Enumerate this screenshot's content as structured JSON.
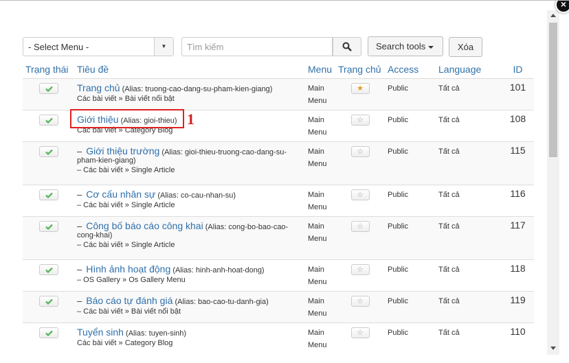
{
  "close_label": "×",
  "toolbar": {
    "select_menu_value": "- Select Menu -",
    "search_placeholder": "Tìm kiếm",
    "search_tools_label": "Search tools",
    "clear_label": "Xóa"
  },
  "table": {
    "headers": {
      "status": "Trạng thái",
      "title": "Tiêu đề",
      "menu": "Menu",
      "home": "Trạng chủ",
      "access": "Access",
      "language": "Language",
      "id": "ID"
    },
    "rows": [
      {
        "title": "Trang chủ",
        "alias": "(Alias: truong-cao-dang-su-pham-kien-giang)",
        "sub": "Các bài viết » Bài viết nổi bật",
        "menu1": "Main",
        "menu2": "Menu",
        "access": "Public",
        "language": "Tất cả",
        "id": "101"
      },
      {
        "title": "Giới thiệu",
        "alias": "(Alias: gioi-thieu)",
        "sub": "Các bài viết » Category Blog",
        "menu1": "Main",
        "menu2": "Menu",
        "access": "Public",
        "language": "Tất cả",
        "id": "108"
      },
      {
        "dash": "–",
        "title": "Giới thiệu trường",
        "alias": "(Alias: gioi-thieu-truong-cao-dang-su-pham-kien-giang)",
        "sub": "– Các bài viết » Single Article",
        "menu1": "Main",
        "menu2": "Menu",
        "access": "Public",
        "language": "Tất cả",
        "id": "115"
      },
      {
        "dash": "–",
        "title": "Cơ cấu nhân sự",
        "alias": "(Alias: co-cau-nhan-su)",
        "sub": "– Các bài viết » Single Article",
        "menu1": "Main",
        "menu2": "Menu",
        "access": "Public",
        "language": "Tất cả",
        "id": "116"
      },
      {
        "dash": "–",
        "title": "Công bố báo cáo công khai",
        "alias": "(Alias: cong-bo-bao-cao-cong-khai)",
        "sub": "– Các bài viết » Single Article",
        "menu1": "Main",
        "menu2": "Menu",
        "access": "Public",
        "language": "Tất cả",
        "id": "117"
      },
      {
        "dash": "–",
        "title": "Hình ảnh hoạt động",
        "alias": "(Alias: hinh-anh-hoat-dong)",
        "sub": "– OS Gallery » Os Gallery Menu",
        "menu1": "Main",
        "menu2": "Menu",
        "access": "Public",
        "language": "Tất cả",
        "id": "118"
      },
      {
        "dash": "–",
        "title": "Báo cáo tự đánh giá",
        "alias": "(Alias: bao-cao-tu-danh-gia)",
        "sub": "– Các bài viết » Bài viết nổi bật",
        "menu1": "Main",
        "menu2": "Menu",
        "access": "Public",
        "language": "Tất cả",
        "id": "119"
      },
      {
        "title": "Tuyển sinh",
        "alias": "(Alias: tuyen-sinh)",
        "sub": "Các bài viết » Category Blog",
        "menu1": "Main",
        "menu2": "Menu",
        "access": "Public",
        "language": "Tất cả",
        "id": "110"
      }
    ]
  },
  "annotation": {
    "number": "1"
  },
  "icons": {
    "check": "check-icon",
    "star": "star-icon",
    "search": "search-icon",
    "close": "close-icon"
  },
  "colors": {
    "link": "#2f6faa",
    "check": "#5cb85c",
    "star_on": "#e39b22",
    "highlight": "#e02020"
  }
}
